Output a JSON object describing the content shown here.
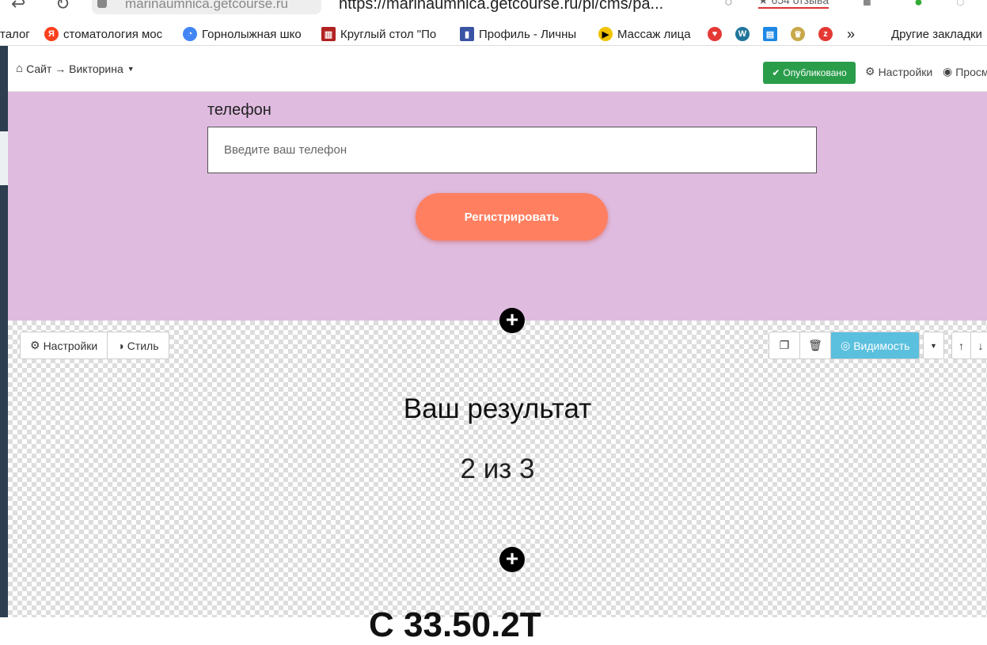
{
  "browser": {
    "site_chip": "marinaumnica.getcourse.ru",
    "url": "https://marinaumnica.getcourse.ru/pl/cms/pa...",
    "rating": "★ 654 отзыва",
    "bookmarks": [
      {
        "label": "талог",
        "icon": "none",
        "color": "#ffffff"
      },
      {
        "label": "стоматология мос",
        "icon": "yandex-icon",
        "color": "#fc3f1d"
      },
      {
        "label": "Горнолыжная шко",
        "icon": "chrome-icon",
        "color": "#4285f4"
      },
      {
        "label": "Круглый стол \"По",
        "icon": "bookmark-icon",
        "color": "#b22222"
      },
      {
        "label": "Профиль - Личны",
        "icon": "book-icon",
        "color": "#3a53a4"
      },
      {
        "label": "Массаж лица",
        "icon": "play-icon",
        "color": "#f2c200"
      }
    ],
    "other_bookmarks": "Другие закладки"
  },
  "cms": {
    "breadcrumb": "Сайт → Викторина",
    "published": "Опубликовано",
    "settings": "Настройки",
    "preview": "Просм"
  },
  "form": {
    "phone_label": "телефон",
    "phone_placeholder": "Введите ваш телефон",
    "register_button": "Регистрировать"
  },
  "block_toolbar": {
    "settings": "Настройки",
    "style": "Стиль",
    "visibility": "Видимость"
  },
  "result": {
    "title": "Ваш результат",
    "score": "2 из 3",
    "partial_next": "С      33.50.2Т"
  },
  "colors": {
    "form_bg": "#dfbbe0",
    "register_btn": "#ff7f60",
    "publish_btn": "#2a9d4b",
    "visibility_btn": "#5bc0de"
  }
}
